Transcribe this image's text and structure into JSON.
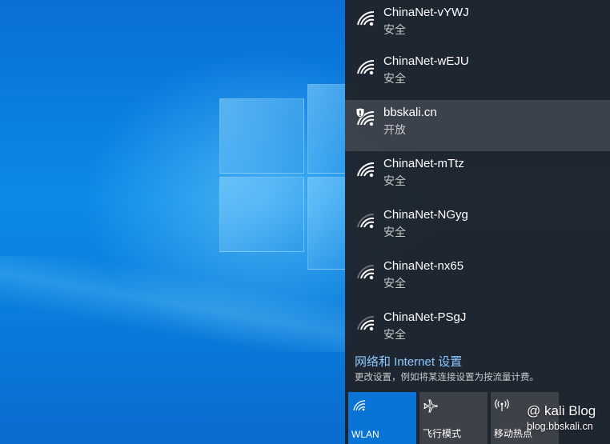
{
  "networks": [
    {
      "name": "ChinaNet-vYWJ",
      "status": "安全",
      "icon": "wifi-icon",
      "signal": "full",
      "selected": false
    },
    {
      "name": "ChinaNet-wEJU",
      "status": "安全",
      "icon": "wifi-icon",
      "signal": "full",
      "selected": false
    },
    {
      "name": "bbskali.cn",
      "status": "开放",
      "icon": "wifi-open-shield-icon",
      "signal": "full",
      "selected": true
    },
    {
      "name": "ChinaNet-mTtz",
      "status": "安全",
      "icon": "wifi-icon",
      "signal": "full",
      "selected": false
    },
    {
      "name": "ChinaNet-NGyg",
      "status": "安全",
      "icon": "wifi-icon",
      "signal": "medium",
      "selected": false
    },
    {
      "name": "ChinaNet-nx65",
      "status": "安全",
      "icon": "wifi-icon",
      "signal": "medium",
      "selected": false
    },
    {
      "name": "ChinaNet-PSgJ",
      "status": "安全",
      "icon": "wifi-icon",
      "signal": "medium",
      "selected": false
    }
  ],
  "settings": {
    "link": "网络和 Internet 设置",
    "description": "更改设置，例如将某连接设置为按流量计费。"
  },
  "quick_actions": [
    {
      "label": "WLAN",
      "icon": "wifi-icon",
      "active": true
    },
    {
      "label": "飞行模式",
      "icon": "airplane-icon",
      "active": false
    },
    {
      "label": "移动热点",
      "icon": "hotspot-icon",
      "active": false
    }
  ],
  "watermark": {
    "line1": "@ kali Blog",
    "line2": "blog.bbskali.cn"
  },
  "colors": {
    "accent": "#0a74d6",
    "link": "#8ec8ff",
    "flyout_bg": "#1f242b"
  }
}
